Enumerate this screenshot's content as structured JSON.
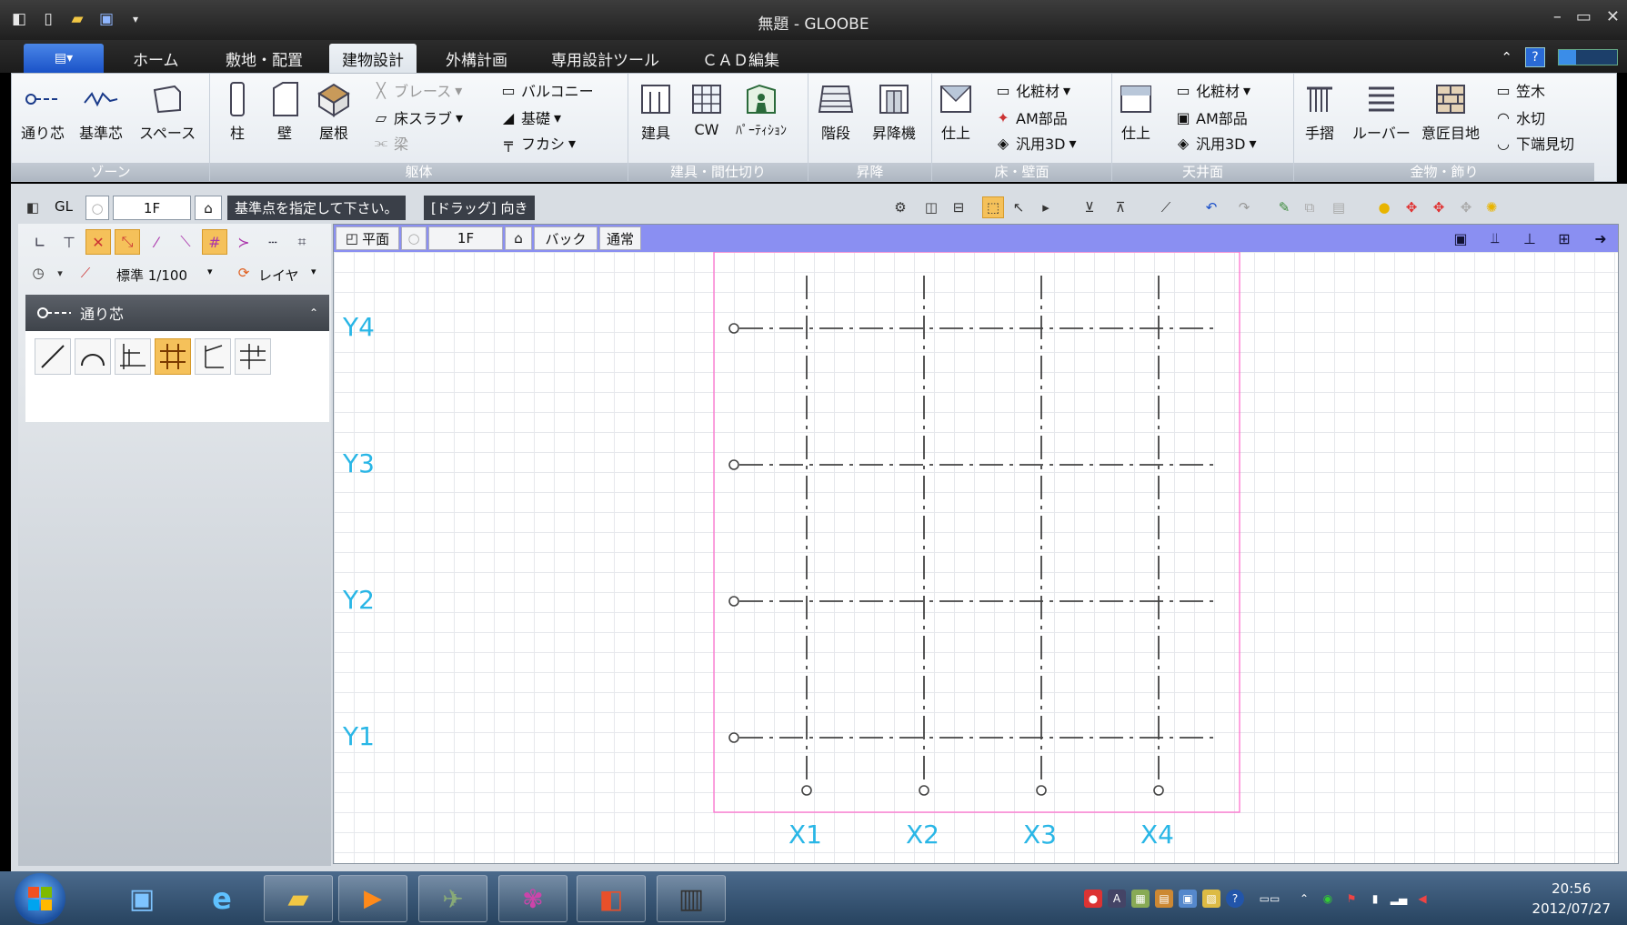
{
  "window": {
    "title": "無題 - GLOOBE",
    "qat_icons": [
      "app-icon",
      "new-icon",
      "open-icon",
      "save-icon",
      "customize-icon"
    ],
    "controls": [
      "–",
      "▭",
      "✕"
    ]
  },
  "ribbon_tabs": {
    "file_label": "▤▾",
    "tabs": [
      "ホーム",
      "敷地・配置",
      "建物設計",
      "外構計画",
      "専用設計ツール",
      "ＣＡＤ編集"
    ],
    "active_index": 2
  },
  "ribbon": {
    "groups": [
      {
        "label": "ゾーン",
        "buttons": [
          "通り芯",
          "基準芯",
          "スペース"
        ]
      },
      {
        "label": "躯体",
        "buttons": [
          "柱",
          "壁",
          "屋根"
        ],
        "small": [
          "ブレース",
          "床スラブ",
          "梁",
          "バルコニー",
          "基礎",
          "フカシ"
        ]
      },
      {
        "label": "建具・間仕切り",
        "buttons": [
          "建具",
          "CW",
          "ﾊﾟｰﾃｨｼｮﾝ"
        ]
      },
      {
        "label": "昇降",
        "buttons": [
          "階段",
          "昇降機"
        ]
      },
      {
        "label": "床・壁面",
        "buttons": [
          "仕上"
        ],
        "small": [
          "化粧材",
          "AM部品",
          "汎用3D"
        ]
      },
      {
        "label": "天井面",
        "buttons": [
          "仕上"
        ],
        "small": [
          "化粧材",
          "AM部品",
          "汎用3D"
        ]
      },
      {
        "label": "金物・飾り",
        "buttons": [
          "手摺",
          "ルーバー",
          "意匠目地"
        ],
        "small": [
          "笠木",
          "水切",
          "下端見切"
        ]
      }
    ]
  },
  "toolbar": {
    "gl_label": "GL",
    "floor": "1F",
    "status_message": "基準点を指定して下さい。",
    "status_hint": "[ドラッグ] 向き"
  },
  "left_panel": {
    "scale": "標準 1/100",
    "layer": "レイヤ",
    "panel_title": "通り芯"
  },
  "view": {
    "tab_plan": "平面",
    "floor": "1F",
    "mode_back": "バック",
    "mode_normal": "通常"
  },
  "grid": {
    "x_labels": [
      "X1",
      "X2",
      "X3",
      "X4"
    ],
    "y_labels": [
      "Y4",
      "Y3",
      "Y2",
      "Y1"
    ],
    "line_color": "#444444",
    "label_color": "#29b6e6",
    "boundary_color": "#ff66cc"
  },
  "taskbar": {
    "apps": [
      "windows-explorer-icon",
      "internet-explorer-icon",
      "folder-icon",
      "media-player-icon",
      "app-icon",
      "app-icon",
      "powerpoint-icon",
      "gloobe-icon"
    ],
    "time": "20:56",
    "date": "2012/07/27"
  }
}
